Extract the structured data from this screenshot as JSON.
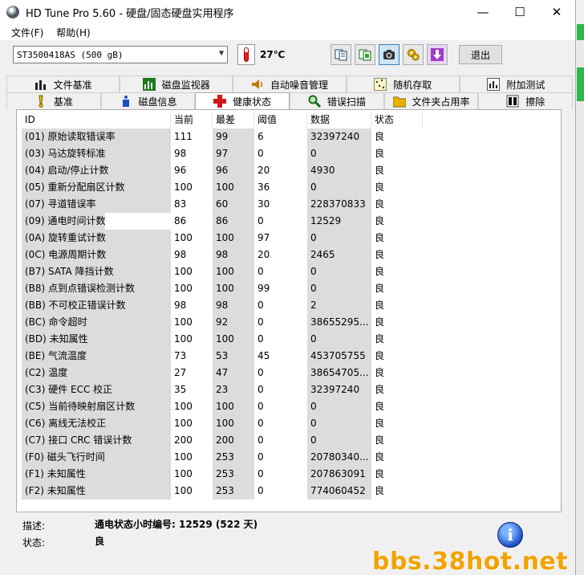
{
  "window": {
    "title": "HD Tune Pro 5.60 - 硬盘/固态硬盘实用程序"
  },
  "menu": {
    "file": "文件(F)",
    "help": "帮助(H)"
  },
  "toolbar": {
    "drive": "ST3500418AS (500 gB)",
    "temperature": "27℃",
    "exit_label": "退出"
  },
  "tabs": {
    "row1": [
      "文件基准",
      "磁盘监视器",
      "自动噪音管理",
      "随机存取",
      "附加测试"
    ],
    "row2": [
      "基准",
      "磁盘信息",
      "健康状态",
      "错误扫描",
      "文件夹占用率",
      "擦除"
    ],
    "active": "健康状态"
  },
  "table": {
    "headers": [
      "ID",
      "当前",
      "最差",
      "阈值",
      "数据",
      "状态"
    ],
    "rows": [
      [
        "(01) 原始读取错误率",
        "111",
        "99",
        "6",
        "32397240",
        "良"
      ],
      [
        "(03) 马达旋转标准",
        "98",
        "97",
        "0",
        "0",
        "良"
      ],
      [
        "(04) 启动/停止计数",
        "96",
        "96",
        "20",
        "4930",
        "良"
      ],
      [
        "(05) 重新分配扇区计数",
        "100",
        "100",
        "36",
        "0",
        "良"
      ],
      [
        "(07) 寻道错误率",
        "83",
        "60",
        "30",
        "228370833",
        "良"
      ],
      [
        "(09) 通电时间计数",
        "86",
        "86",
        "0",
        "12529",
        "良"
      ],
      [
        "(0A) 旋转重试计数",
        "100",
        "100",
        "97",
        "0",
        "良"
      ],
      [
        "(0C) 电源周期计数",
        "98",
        "98",
        "20",
        "2465",
        "良"
      ],
      [
        "(B7) SATA 降挡计数",
        "100",
        "100",
        "0",
        "0",
        "良"
      ],
      [
        "(B8) 点到点错误检测计数",
        "100",
        "100",
        "99",
        "0",
        "良"
      ],
      [
        "(BB) 不可校正错误计数",
        "98",
        "98",
        "0",
        "2",
        "良"
      ],
      [
        "(BC) 命令超时",
        "100",
        "92",
        "0",
        "38655295...",
        "良"
      ],
      [
        "(BD) 未知属性",
        "100",
        "100",
        "0",
        "0",
        "良"
      ],
      [
        "(BE) 气流温度",
        "73",
        "53",
        "45",
        "453705755",
        "良"
      ],
      [
        "(C2) 温度",
        "27",
        "47",
        "0",
        "38654705...",
        "良"
      ],
      [
        "(C3) 硬件 ECC 校正",
        "35",
        "23",
        "0",
        "32397240",
        "良"
      ],
      [
        "(C5) 当前待映射扇区计数",
        "100",
        "100",
        "0",
        "0",
        "良"
      ],
      [
        "(C6) 离线无法校正",
        "100",
        "100",
        "0",
        "0",
        "良"
      ],
      [
        "(C7) 接口 CRC 错误计数",
        "200",
        "200",
        "0",
        "0",
        "良"
      ],
      [
        "(F0) 磁头飞行时间",
        "100",
        "253",
        "0",
        "20780340...",
        "良"
      ],
      [
        "(F1) 未知属性",
        "100",
        "253",
        "0",
        "207863091",
        "良"
      ],
      [
        "(F2) 未知属性",
        "100",
        "253",
        "0",
        "774060452",
        "良"
      ]
    ]
  },
  "footer": {
    "desc_label": "描述:",
    "desc_value": "通电状态小时编号: 12529 (522 天)",
    "status_label": "状态:",
    "status_value": "良"
  },
  "watermark": "bbs.38hot.net"
}
